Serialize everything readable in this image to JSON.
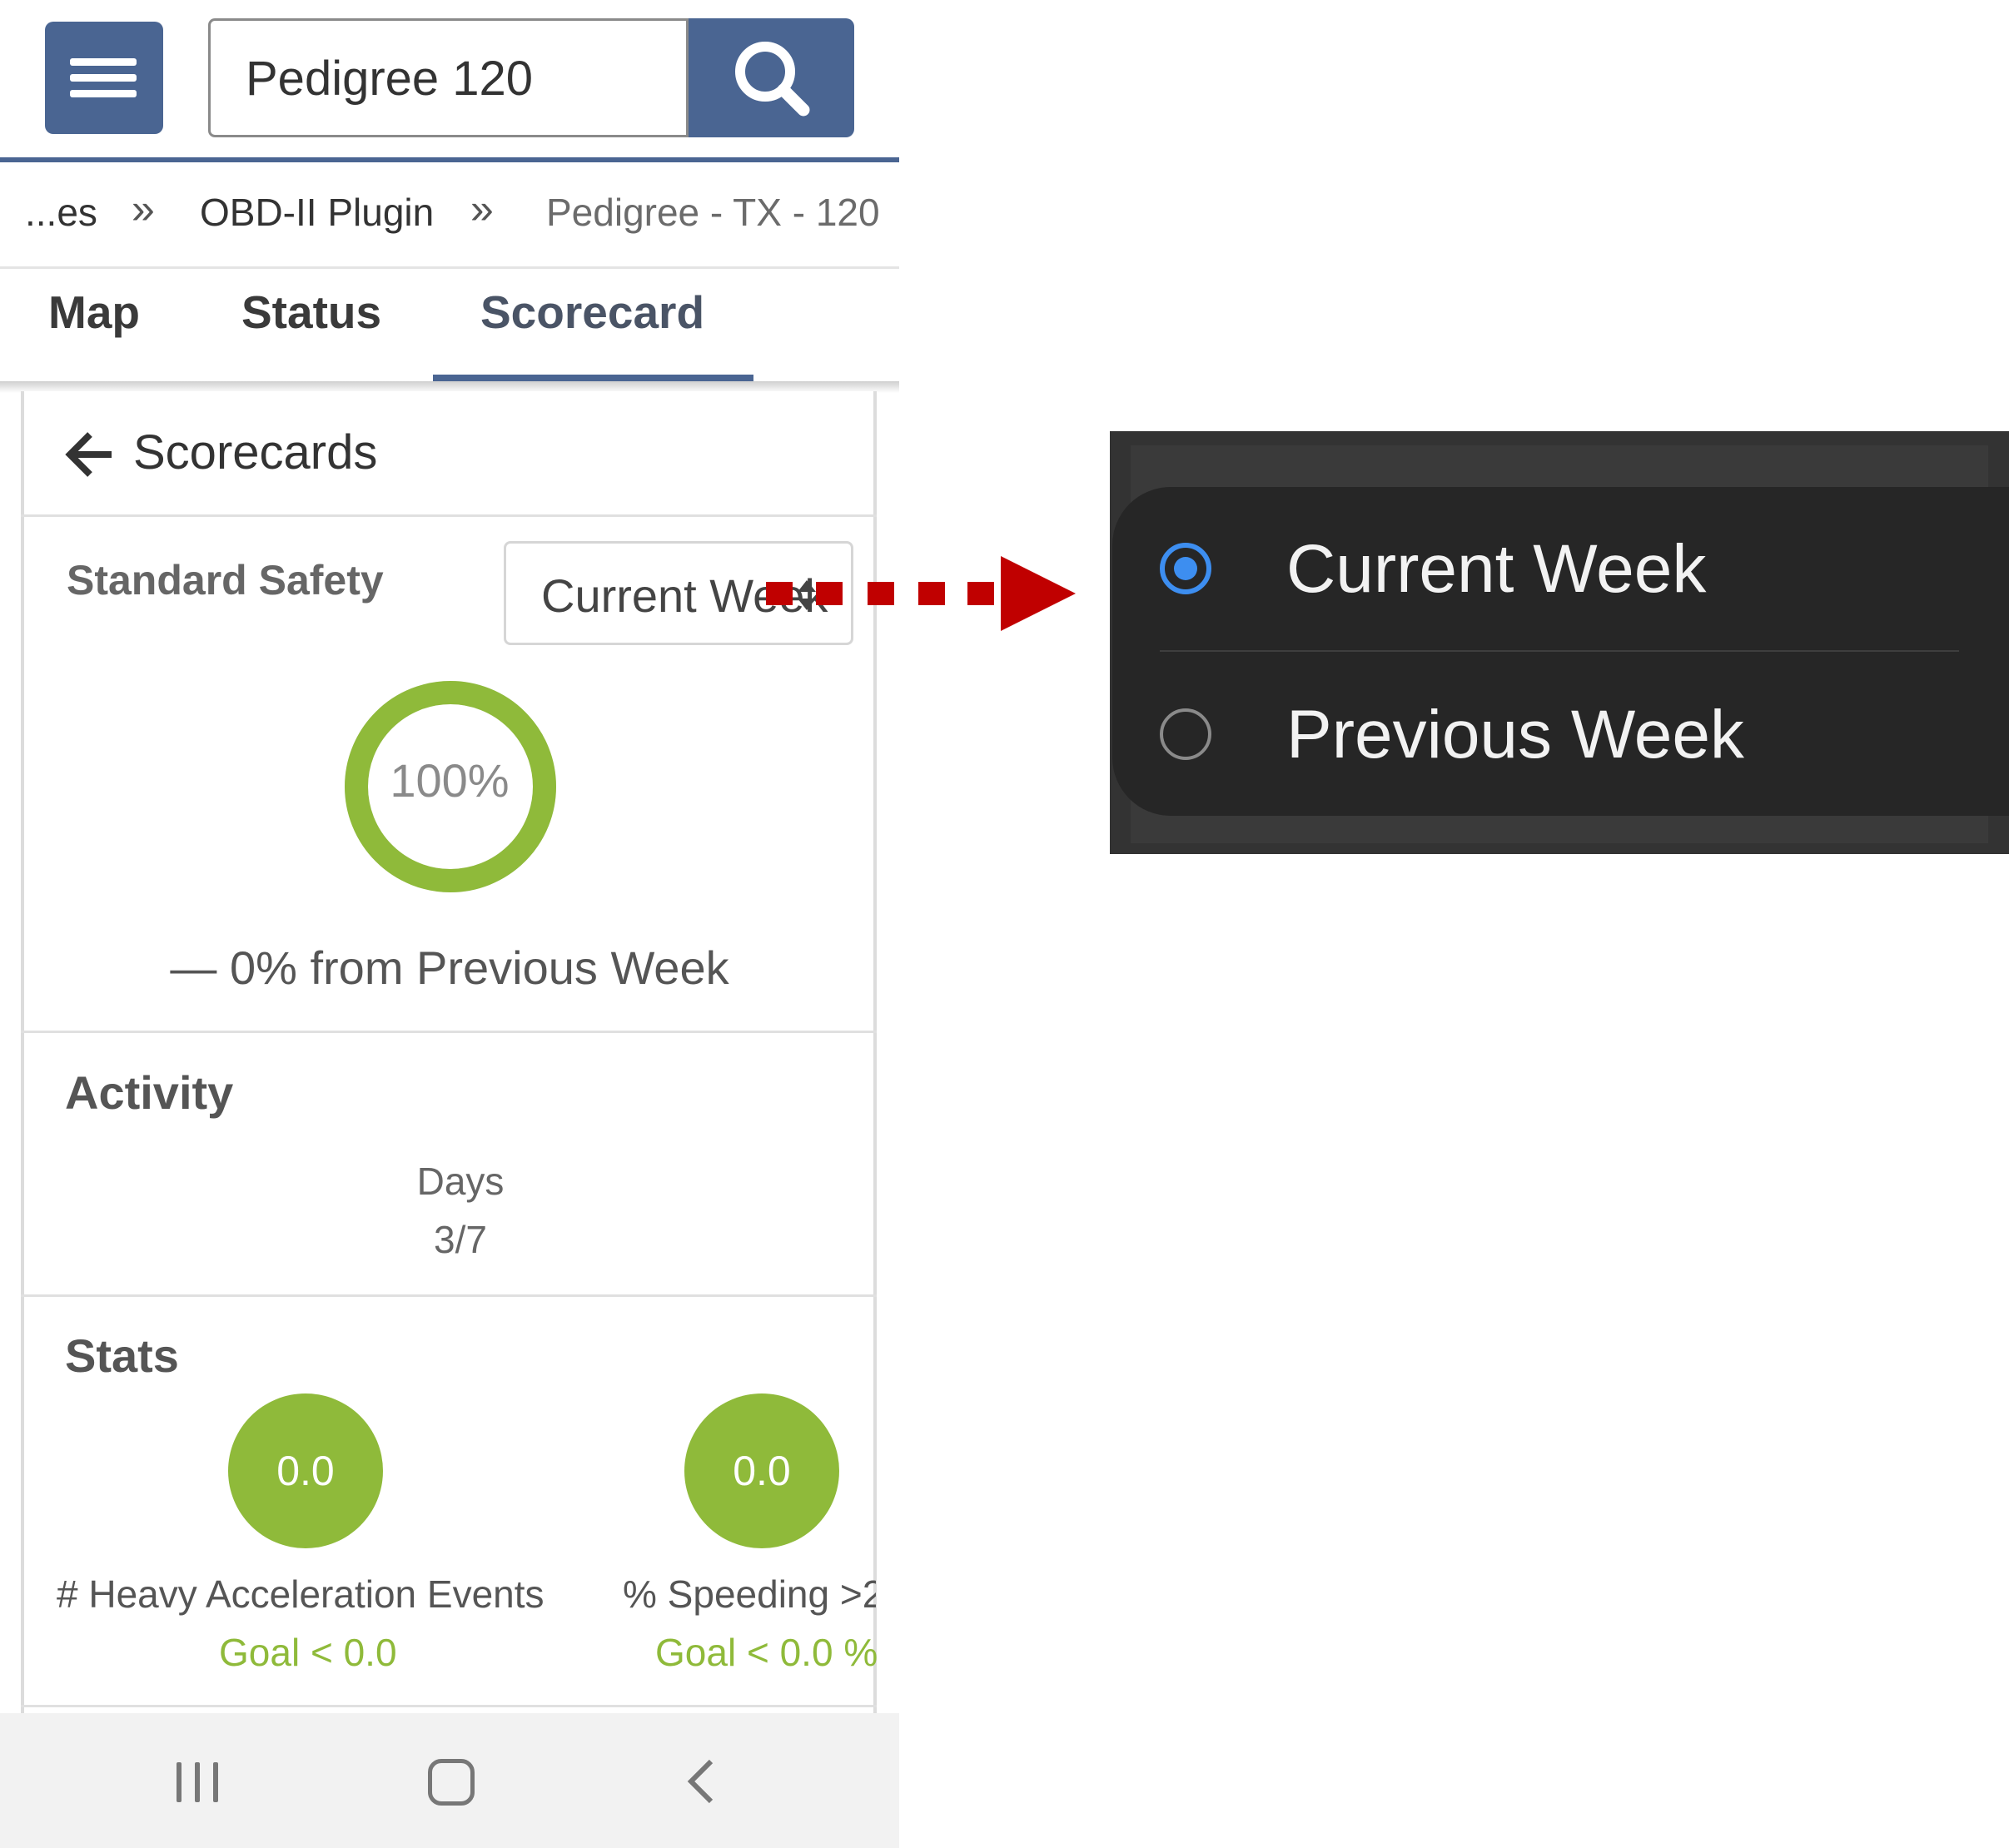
{
  "header": {
    "search_value": "Pedigree 120"
  },
  "breadcrumb": {
    "items": [
      "...es",
      "OBD-II Plugin",
      "Pedigree - TX - 120"
    ]
  },
  "tabs": [
    {
      "label": "Map"
    },
    {
      "label": "Status"
    },
    {
      "label": "Scorecard"
    }
  ],
  "card": {
    "back_label": "Scorecards",
    "scorecard_name": "Standard Safety",
    "period_select_value": "Current Week",
    "score_percent": "100%",
    "score_fraction": 1.0,
    "change_text": "— 0% from Previous Week"
  },
  "activity": {
    "title": "Activity",
    "days_label": "Days",
    "days_value": "3/7"
  },
  "stats": {
    "title": "Stats",
    "items": [
      {
        "value": "0.0",
        "label": "# Heavy Acceleration Events",
        "goal": "Goal < 0.0"
      },
      {
        "value": "0.0",
        "label": "% Speeding >2",
        "goal": "Goal < 0.0 %"
      }
    ]
  },
  "dropdown_options": [
    {
      "label": "Current Week",
      "selected": true
    },
    {
      "label": "Previous Week",
      "selected": false
    }
  ],
  "colors": {
    "brand_blue": "#4a6592",
    "score_green": "#8fba3a",
    "radio_blue": "#3d8ef0",
    "arrow_red": "#c00000"
  },
  "icons": [
    "menu-icon",
    "search-icon",
    "chevron-double-right-icon",
    "arrow-left-icon",
    "select-arrows-icon",
    "recents-icon",
    "home-icon",
    "back-icon"
  ]
}
